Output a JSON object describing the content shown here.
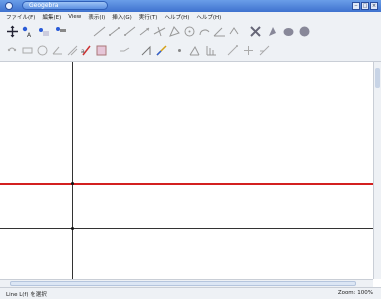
{
  "window": {
    "title": "Geogebra"
  },
  "menu": [
    "ファイル(F)",
    "編集(E)",
    "View",
    "表示(I)",
    "挿入(G)",
    "実行(T)",
    "ヘルプ(H)",
    "ヘルプ(H)"
  ],
  "status": {
    "left": "Line L(f) を選択",
    "right": "Zoom: 100%"
  },
  "colors": {
    "accent_line": "#d32020",
    "axis": "#333333"
  },
  "toolbar_row1_icons": [
    "move-icon",
    "point-icon",
    "point-on-object-icon",
    "point-label-icon",
    "line-icon",
    "segment-icon",
    "ray-icon",
    "vector-icon",
    "perpendicular-icon",
    "polygon-icon",
    "circle-icon",
    "arc-icon",
    "angle-icon",
    "transform-icon",
    "reflect-icon",
    "slider-icon",
    "text-icon",
    "fill-icon"
  ],
  "toolbar_row2_icons": [
    "locus-icon",
    "measure-icon",
    "circle-tool-icon",
    "angle-tool-icon",
    "compass-icon",
    "pen-icon",
    "image-icon",
    "function-icon",
    "slope-icon",
    "line-draw-icon",
    "dot-icon",
    "triangle-icon",
    "graph-icon",
    "dilate-icon",
    "translate-icon",
    "scale-icon"
  ]
}
